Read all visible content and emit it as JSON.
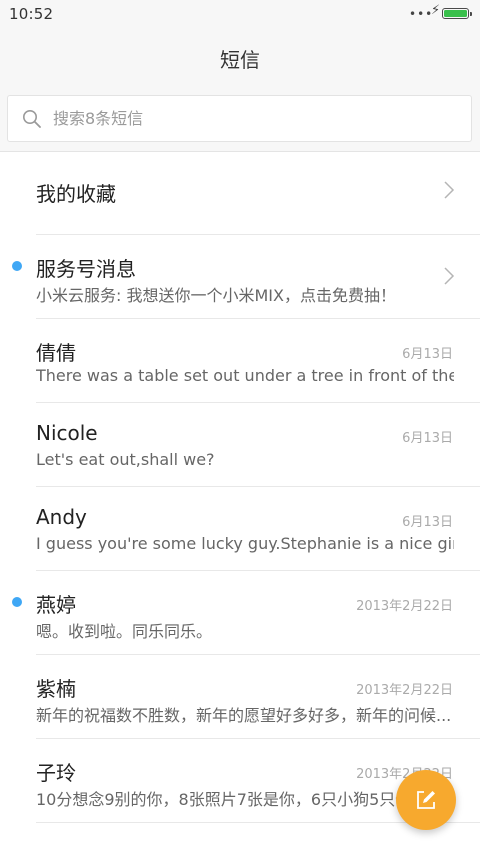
{
  "status_bar": {
    "time": "10:52",
    "dots": "•••",
    "bolt": "⚡",
    "battery_level": 1.0,
    "battery_color": "#39c04b"
  },
  "header": {
    "title": "短信"
  },
  "search": {
    "placeholder": "搜索8条短信",
    "value": ""
  },
  "favorites": {
    "title": "我的收藏"
  },
  "conversations": [
    {
      "name": "服务号消息",
      "preview": "小米云服务: 我想送你一个小米MIX，点击免费抽！",
      "date": "",
      "unread": true
    },
    {
      "name": "倩倩",
      "preview": "There was a table set out under a tree in front of the ho...",
      "date": "6月13日",
      "unread": false
    },
    {
      "name": "Nicole",
      "preview": "Let's eat out,shall we?",
      "date": "6月13日",
      "unread": false
    },
    {
      "name": "Andy",
      "preview": "I guess you're some lucky guy.Stephanie is a nice girl.",
      "date": "6月13日",
      "unread": false
    },
    {
      "name": "燕婷",
      "preview": "嗯。收到啦。同乐同乐。",
      "date": "2013年2月22日",
      "unread": true
    },
    {
      "name": "紫楠",
      "preview": "新年的祝福数不胜数，新年的愿望好多好多，新年的问候...",
      "date": "2013年2月22日",
      "unread": false
    },
    {
      "name": "子玲",
      "preview": "10分想念9别的你，8张照片7张是你，6只小狗5只像你",
      "date": "2013年2月22日",
      "unread": false
    }
  ],
  "colors": {
    "accent_fab": "#f7a92e",
    "unread_dot": "#3fa7f5"
  },
  "icons": {
    "compose": "compose-icon",
    "search": "search-icon",
    "chevron": "chevron-right-icon"
  }
}
